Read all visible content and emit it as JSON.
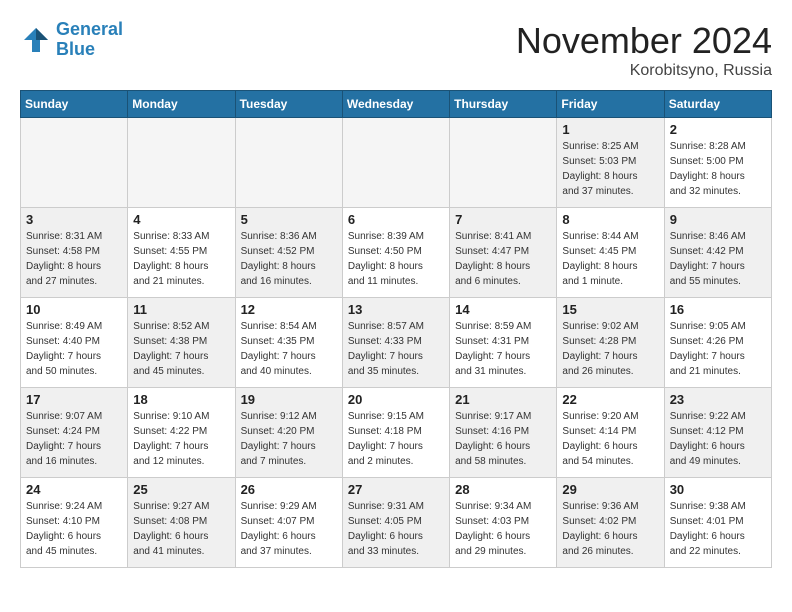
{
  "header": {
    "logo_line1": "General",
    "logo_line2": "Blue",
    "month": "November 2024",
    "location": "Korobitsyno, Russia"
  },
  "weekdays": [
    "Sunday",
    "Monday",
    "Tuesday",
    "Wednesday",
    "Thursday",
    "Friday",
    "Saturday"
  ],
  "weeks": [
    [
      {
        "day": "",
        "info": "",
        "empty": true
      },
      {
        "day": "",
        "info": "",
        "empty": true
      },
      {
        "day": "",
        "info": "",
        "empty": true
      },
      {
        "day": "",
        "info": "",
        "empty": true
      },
      {
        "day": "",
        "info": "",
        "empty": true
      },
      {
        "day": "1",
        "info": "Sunrise: 8:25 AM\nSunset: 5:03 PM\nDaylight: 8 hours\nand 37 minutes.",
        "shaded": true
      },
      {
        "day": "2",
        "info": "Sunrise: 8:28 AM\nSunset: 5:00 PM\nDaylight: 8 hours\nand 32 minutes.",
        "shaded": false
      }
    ],
    [
      {
        "day": "3",
        "info": "Sunrise: 8:31 AM\nSunset: 4:58 PM\nDaylight: 8 hours\nand 27 minutes.",
        "shaded": true
      },
      {
        "day": "4",
        "info": "Sunrise: 8:33 AM\nSunset: 4:55 PM\nDaylight: 8 hours\nand 21 minutes.",
        "shaded": false
      },
      {
        "day": "5",
        "info": "Sunrise: 8:36 AM\nSunset: 4:52 PM\nDaylight: 8 hours\nand 16 minutes.",
        "shaded": true
      },
      {
        "day": "6",
        "info": "Sunrise: 8:39 AM\nSunset: 4:50 PM\nDaylight: 8 hours\nand 11 minutes.",
        "shaded": false
      },
      {
        "day": "7",
        "info": "Sunrise: 8:41 AM\nSunset: 4:47 PM\nDaylight: 8 hours\nand 6 minutes.",
        "shaded": true
      },
      {
        "day": "8",
        "info": "Sunrise: 8:44 AM\nSunset: 4:45 PM\nDaylight: 8 hours\nand 1 minute.",
        "shaded": false
      },
      {
        "day": "9",
        "info": "Sunrise: 8:46 AM\nSunset: 4:42 PM\nDaylight: 7 hours\nand 55 minutes.",
        "shaded": true
      }
    ],
    [
      {
        "day": "10",
        "info": "Sunrise: 8:49 AM\nSunset: 4:40 PM\nDaylight: 7 hours\nand 50 minutes.",
        "shaded": false
      },
      {
        "day": "11",
        "info": "Sunrise: 8:52 AM\nSunset: 4:38 PM\nDaylight: 7 hours\nand 45 minutes.",
        "shaded": true
      },
      {
        "day": "12",
        "info": "Sunrise: 8:54 AM\nSunset: 4:35 PM\nDaylight: 7 hours\nand 40 minutes.",
        "shaded": false
      },
      {
        "day": "13",
        "info": "Sunrise: 8:57 AM\nSunset: 4:33 PM\nDaylight: 7 hours\nand 35 minutes.",
        "shaded": true
      },
      {
        "day": "14",
        "info": "Sunrise: 8:59 AM\nSunset: 4:31 PM\nDaylight: 7 hours\nand 31 minutes.",
        "shaded": false
      },
      {
        "day": "15",
        "info": "Sunrise: 9:02 AM\nSunset: 4:28 PM\nDaylight: 7 hours\nand 26 minutes.",
        "shaded": true
      },
      {
        "day": "16",
        "info": "Sunrise: 9:05 AM\nSunset: 4:26 PM\nDaylight: 7 hours\nand 21 minutes.",
        "shaded": false
      }
    ],
    [
      {
        "day": "17",
        "info": "Sunrise: 9:07 AM\nSunset: 4:24 PM\nDaylight: 7 hours\nand 16 minutes.",
        "shaded": true
      },
      {
        "day": "18",
        "info": "Sunrise: 9:10 AM\nSunset: 4:22 PM\nDaylight: 7 hours\nand 12 minutes.",
        "shaded": false
      },
      {
        "day": "19",
        "info": "Sunrise: 9:12 AM\nSunset: 4:20 PM\nDaylight: 7 hours\nand 7 minutes.",
        "shaded": true
      },
      {
        "day": "20",
        "info": "Sunrise: 9:15 AM\nSunset: 4:18 PM\nDaylight: 7 hours\nand 2 minutes.",
        "shaded": false
      },
      {
        "day": "21",
        "info": "Sunrise: 9:17 AM\nSunset: 4:16 PM\nDaylight: 6 hours\nand 58 minutes.",
        "shaded": true
      },
      {
        "day": "22",
        "info": "Sunrise: 9:20 AM\nSunset: 4:14 PM\nDaylight: 6 hours\nand 54 minutes.",
        "shaded": false
      },
      {
        "day": "23",
        "info": "Sunrise: 9:22 AM\nSunset: 4:12 PM\nDaylight: 6 hours\nand 49 minutes.",
        "shaded": true
      }
    ],
    [
      {
        "day": "24",
        "info": "Sunrise: 9:24 AM\nSunset: 4:10 PM\nDaylight: 6 hours\nand 45 minutes.",
        "shaded": false
      },
      {
        "day": "25",
        "info": "Sunrise: 9:27 AM\nSunset: 4:08 PM\nDaylight: 6 hours\nand 41 minutes.",
        "shaded": true
      },
      {
        "day": "26",
        "info": "Sunrise: 9:29 AM\nSunset: 4:07 PM\nDaylight: 6 hours\nand 37 minutes.",
        "shaded": false
      },
      {
        "day": "27",
        "info": "Sunrise: 9:31 AM\nSunset: 4:05 PM\nDaylight: 6 hours\nand 33 minutes.",
        "shaded": true
      },
      {
        "day": "28",
        "info": "Sunrise: 9:34 AM\nSunset: 4:03 PM\nDaylight: 6 hours\nand 29 minutes.",
        "shaded": false
      },
      {
        "day": "29",
        "info": "Sunrise: 9:36 AM\nSunset: 4:02 PM\nDaylight: 6 hours\nand 26 minutes.",
        "shaded": true
      },
      {
        "day": "30",
        "info": "Sunrise: 9:38 AM\nSunset: 4:01 PM\nDaylight: 6 hours\nand 22 minutes.",
        "shaded": false
      }
    ]
  ]
}
